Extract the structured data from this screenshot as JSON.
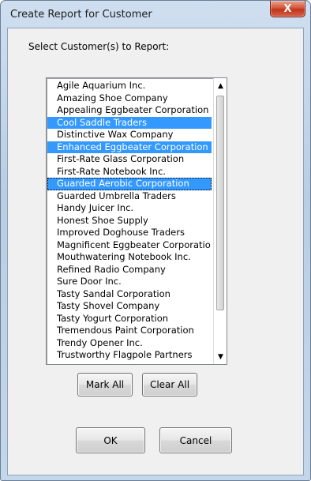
{
  "window": {
    "title": "Create Report for Customer",
    "close_label": "X"
  },
  "prompt": "Select Customer(s) to Report:",
  "list": {
    "items": [
      {
        "label": "Agile Aquarium Inc.",
        "selected": false,
        "focused": false
      },
      {
        "label": "Amazing Shoe Company",
        "selected": false,
        "focused": false
      },
      {
        "label": "Appealing Eggbeater Corporation",
        "selected": false,
        "focused": false
      },
      {
        "label": "Cool Saddle Traders",
        "selected": true,
        "focused": false
      },
      {
        "label": "Distinctive Wax Company",
        "selected": false,
        "focused": false
      },
      {
        "label": "Enhanced Eggbeater Corporation",
        "selected": true,
        "focused": false
      },
      {
        "label": "First-Rate Glass Corporation",
        "selected": false,
        "focused": false
      },
      {
        "label": "First-Rate Notebook Inc.",
        "selected": false,
        "focused": false
      },
      {
        "label": "Guarded Aerobic Corporation",
        "selected": true,
        "focused": true
      },
      {
        "label": "Guarded Umbrella Traders",
        "selected": false,
        "focused": false
      },
      {
        "label": "Handy Juicer Inc.",
        "selected": false,
        "focused": false
      },
      {
        "label": "Honest Shoe Supply",
        "selected": false,
        "focused": false
      },
      {
        "label": "Improved Doghouse Traders",
        "selected": false,
        "focused": false
      },
      {
        "label": "Magnificent Eggbeater Corporatio",
        "selected": false,
        "focused": false
      },
      {
        "label": "Mouthwatering Notebook Inc.",
        "selected": false,
        "focused": false
      },
      {
        "label": "Refined Radio Company",
        "selected": false,
        "focused": false
      },
      {
        "label": "Sure Door Inc.",
        "selected": false,
        "focused": false
      },
      {
        "label": "Tasty Sandal Corporation",
        "selected": false,
        "focused": false
      },
      {
        "label": "Tasty Shovel Company",
        "selected": false,
        "focused": false
      },
      {
        "label": "Tasty Yogurt Corporation",
        "selected": false,
        "focused": false
      },
      {
        "label": "Tremendous Paint Corporation",
        "selected": false,
        "focused": false
      },
      {
        "label": "Trendy Opener Inc.",
        "selected": false,
        "focused": false
      },
      {
        "label": "Trustworthy Flagpole Partners",
        "selected": false,
        "focused": false
      }
    ],
    "scroll_up_icon": "triangle-up-icon",
    "scroll_down_icon": "triangle-down-icon"
  },
  "buttons": {
    "mark_all": "Mark All",
    "clear_all": "Clear All",
    "ok": "OK",
    "cancel": "Cancel"
  },
  "colors": {
    "selection": "#3399ff",
    "close_button": "#c2341a"
  }
}
